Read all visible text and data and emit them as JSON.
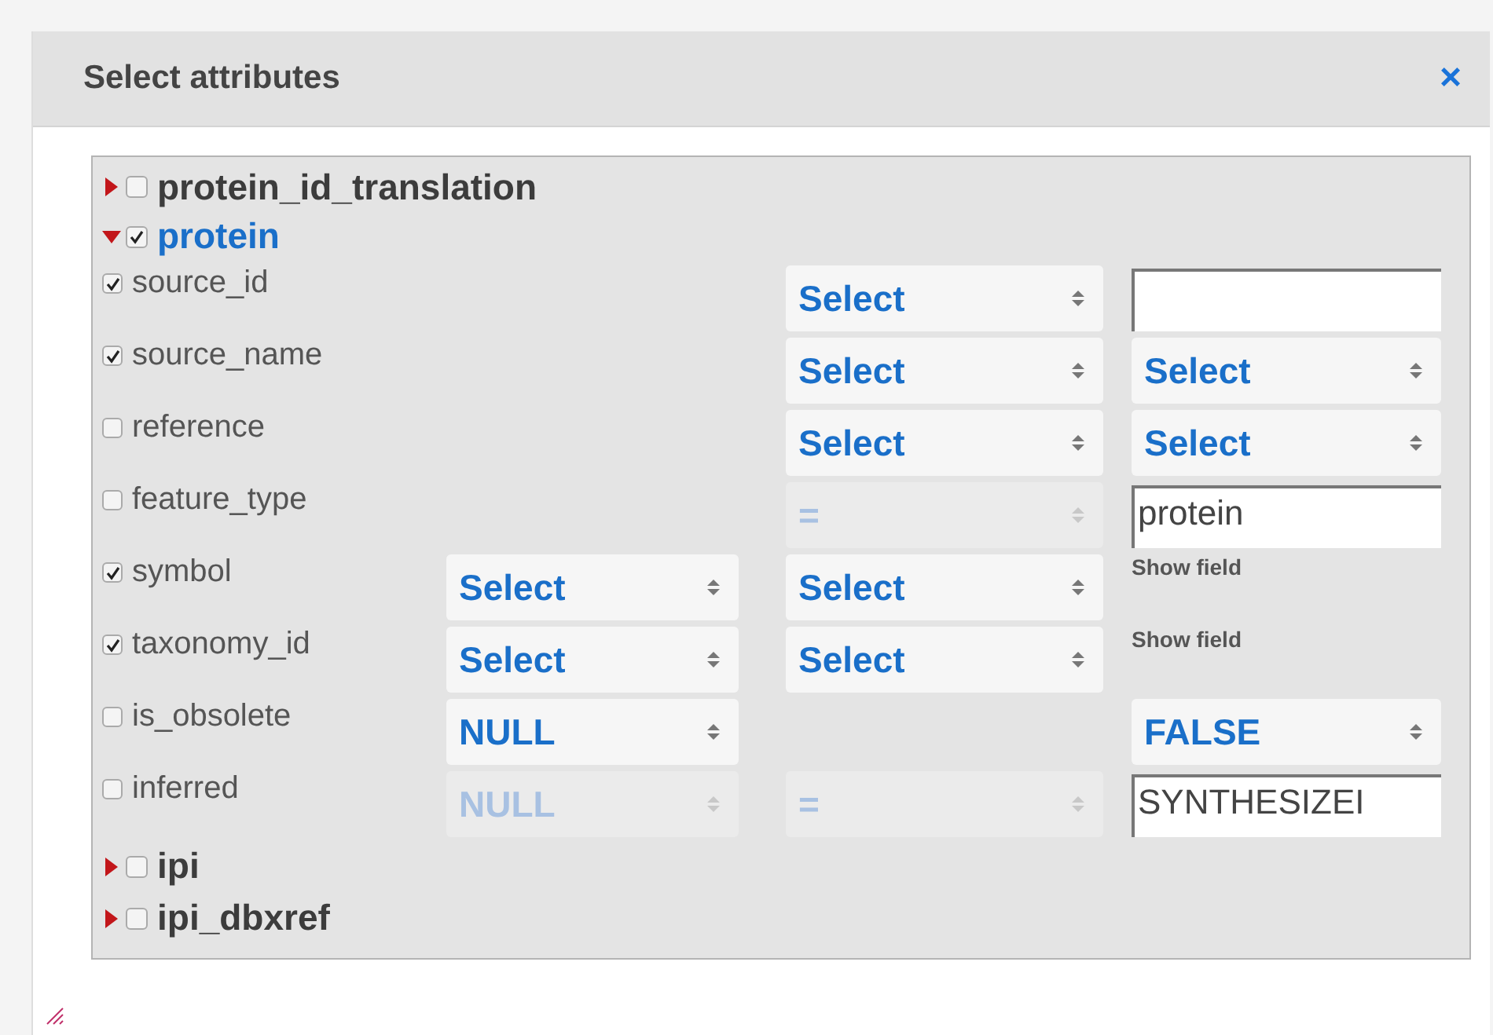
{
  "dialog": {
    "title": "Select attributes",
    "close": "×"
  },
  "tree": [
    {
      "label": "protein_id_translation",
      "expanded": false,
      "checked": false
    },
    {
      "label": "protein",
      "expanded": true,
      "checked": true,
      "attributes": [
        {
          "name": "source_id",
          "checked": true,
          "column_2": {
            "kind": "select",
            "value": "Select",
            "disabled": false
          },
          "column_3": {
            "kind": "text"
          }
        },
        {
          "name": "source_name",
          "checked": true,
          "column_2": {
            "kind": "select",
            "value": "Select",
            "disabled": false
          },
          "column_3": {
            "kind": "select",
            "value": "Select",
            "disabled": false
          }
        },
        {
          "name": "reference",
          "checked": false,
          "column_2": {
            "kind": "select",
            "value": "Select",
            "disabled": false
          },
          "column_3": {
            "kind": "select",
            "value": "Select",
            "disabled": false
          }
        },
        {
          "name": "feature_type",
          "checked": false,
          "column_2": {
            "kind": "select",
            "value": "=",
            "disabled": true
          },
          "column_3": {
            "kind": "text",
            "value": "protein"
          }
        },
        {
          "name": "symbol",
          "checked": true,
          "column_1": {
            "kind": "select",
            "value": "Select",
            "disabled": false
          },
          "column_2": {
            "kind": "select",
            "value": "Select",
            "disabled": false
          },
          "column_3": {
            "kind": "link",
            "text": "Show field"
          }
        },
        {
          "name": "taxonomy_id",
          "checked": true,
          "column_1": {
            "kind": "select",
            "value": "Select",
            "disabled": false
          },
          "column_2": {
            "kind": "select",
            "value": "Select",
            "disabled": false
          },
          "column_3": {
            "kind": "link",
            "text": "Show field"
          }
        },
        {
          "name": "is_obsolete",
          "checked": false,
          "column_1": {
            "kind": "select",
            "value": "NULL",
            "disabled": false
          },
          "column_3": {
            "kind": "select",
            "value": "FALSE",
            "disabled": false
          }
        },
        {
          "name": "inferred",
          "checked": false,
          "column_1": {
            "kind": "select",
            "value": "NULL",
            "disabled": true
          },
          "column_2": {
            "kind": "select",
            "value": "=",
            "disabled": true
          },
          "column_3": {
            "kind": "text",
            "value": "SYNTHESIZEI"
          }
        }
      ]
    },
    {
      "label": "ipi",
      "expanded": false,
      "checked": false
    },
    {
      "label": "ipi_dbxref",
      "expanded": false,
      "checked": false
    }
  ]
}
